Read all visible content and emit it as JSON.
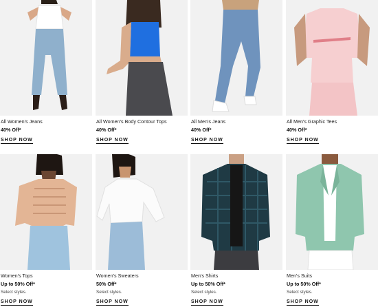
{
  "products": [
    {
      "name": "All Women's Jeans",
      "promo": "40% Off*",
      "note": "",
      "cta": "SHOP NOW",
      "image_icon": "womens-jeans-photo"
    },
    {
      "name": "All Women's Body Contour Tops",
      "promo": "40% Off*",
      "note": "",
      "cta": "SHOP NOW",
      "image_icon": "body-contour-top-photo"
    },
    {
      "name": "All Men's Jeans",
      "promo": "40% Off*",
      "note": "",
      "cta": "SHOP NOW",
      "image_icon": "mens-jeans-photo"
    },
    {
      "name": "All Men's Graphic Tees",
      "promo": "40% Off*",
      "note": "",
      "cta": "SHOP NOW",
      "image_icon": "graphic-tee-photo"
    },
    {
      "name": "Women's Tops",
      "promo": "Up to 50% Off*",
      "note": "Select styles.",
      "cta": "SHOP NOW",
      "image_icon": "womens-top-photo"
    },
    {
      "name": "Women's Sweaters",
      "promo": "50% Off*",
      "note": "Select styles.",
      "cta": "SHOP NOW",
      "image_icon": "womens-sweater-photo"
    },
    {
      "name": "Men's Shirts",
      "promo": "Up to 50% Off*",
      "note": "Select styles.",
      "cta": "SHOP NOW",
      "image_icon": "mens-shirt-photo"
    },
    {
      "name": "Men's Suits",
      "promo": "Up to 50% Off*",
      "note": "Select styles.",
      "cta": "SHOP NOW",
      "image_icon": "mens-suit-photo"
    }
  ],
  "colors": {
    "image_bg": "#f1f1f1",
    "text": "#111111",
    "denim": "#8fb0cc",
    "blue_top": "#1f6fe0",
    "pink_tee": "#f6cfd0",
    "nude_top": "#e3b595",
    "plaid": "#1f3a44",
    "mint_suit": "#8fc6ae"
  }
}
